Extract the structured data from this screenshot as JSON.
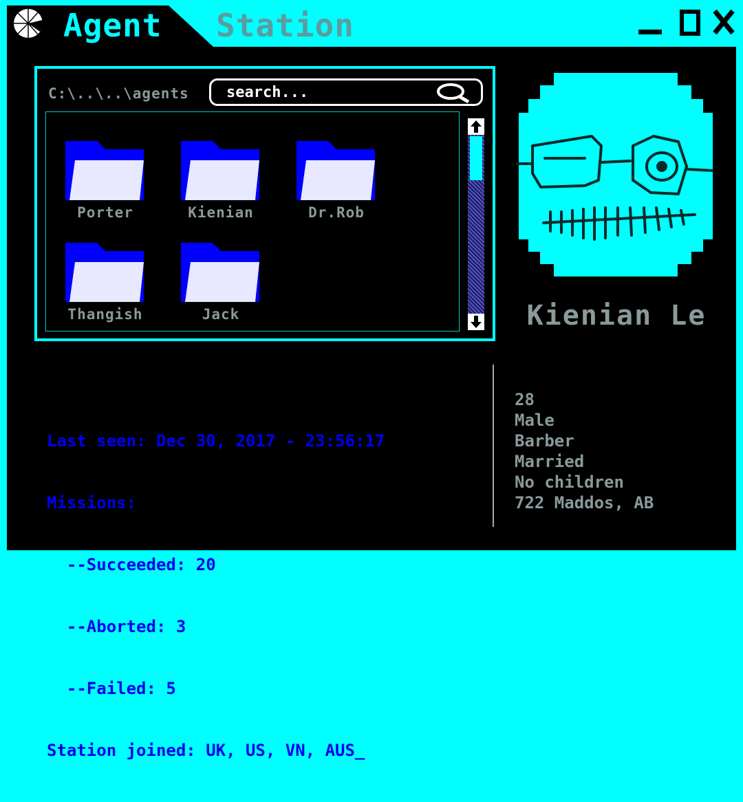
{
  "titlebar": {
    "tabs": [
      {
        "label": "Agent",
        "active": true
      },
      {
        "label": "Station",
        "active": false
      }
    ],
    "logo_icon": "aperture-logo-icon",
    "window_controls": [
      "minimize-icon",
      "maximize-icon",
      "close-icon"
    ]
  },
  "explorer": {
    "path": "C:\\..\\..\\agents",
    "search": {
      "placeholder": "search...",
      "value": ""
    },
    "folders": [
      {
        "label": "Porter"
      },
      {
        "label": "Kienian"
      },
      {
        "label": "Dr.Rob"
      },
      {
        "label": "Thangish"
      },
      {
        "label": "Jack"
      }
    ],
    "folder_color": "#0000ff"
  },
  "agent": {
    "name": "Kienian Le",
    "avatar_icon": "agent-avatar-icon",
    "stats": {
      "last_seen": "Last seen: Dec 30, 2017 - 23:56:17",
      "missions": "Missions:",
      "succeeded": "  --Succeeded: 20",
      "aborted": "  --Aborted: 3",
      "failed": "  --Failed: 5",
      "stations": "Station joined: UK, US, VN, AUS_"
    },
    "profile": {
      "age": "28",
      "gender": "Male",
      "occupation": "Barber",
      "marital": "Married",
      "children": "No children",
      "address": "722 Maddos, AB"
    }
  },
  "colors": {
    "accent": "#00ffff",
    "background": "#000000",
    "stats_text": "#0000ee",
    "muted_text": "#8a9a9a"
  }
}
